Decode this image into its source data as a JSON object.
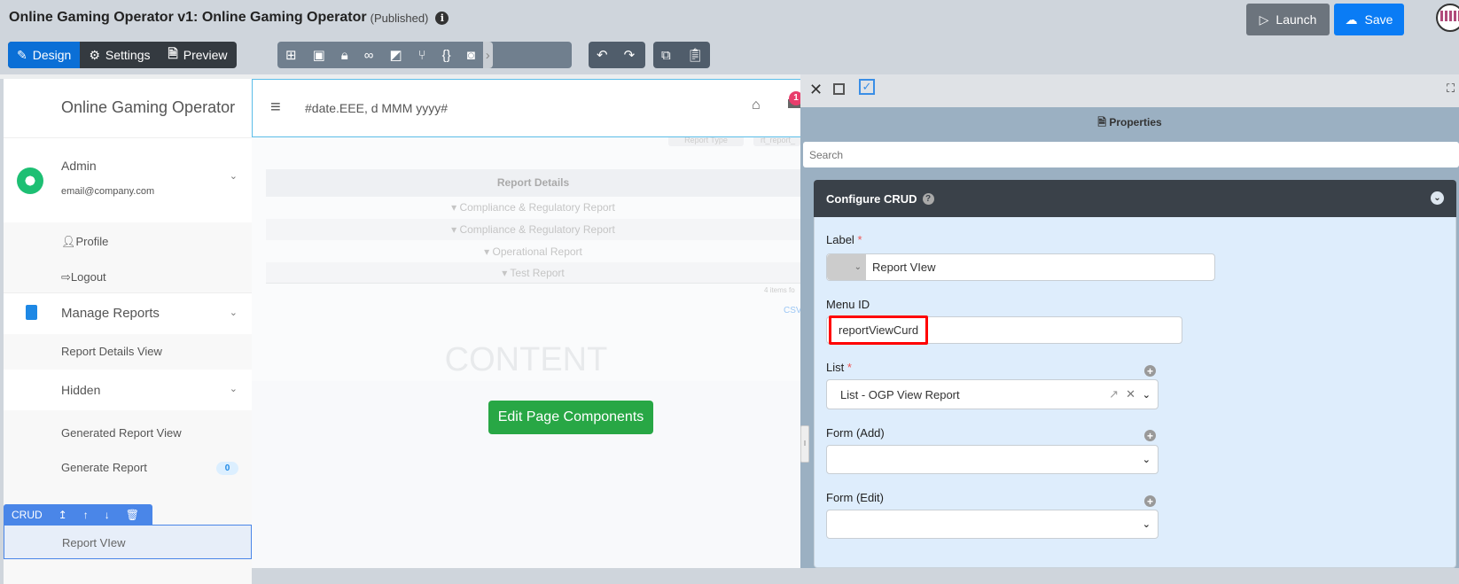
{
  "header": {
    "title": "Online Gaming Operator v1: Online Gaming Operator",
    "status": "(Published)",
    "launch": "Launch",
    "save": "Save"
  },
  "modes": [
    {
      "label": "Design"
    },
    {
      "label": "Settings"
    },
    {
      "label": "Preview"
    }
  ],
  "toolbar_icons": [
    "sitemap-icon",
    "page-icon",
    "lock-icon",
    "binoculars-icon",
    "translate-icon",
    "branch-icon",
    "code-braces-icon",
    "camera-icon"
  ],
  "app": {
    "brand": "Online Gaming Operator",
    "date_format": "#date.EEE, d MMM yyyy#",
    "notification_count": "1"
  },
  "sidebar": {
    "user_name": "Admin",
    "user_email": "email@company.com",
    "profile": "Profile",
    "logout": "Logout",
    "manage_reports": "Manage Reports",
    "report_details_view": "Report Details View",
    "hidden": "Hidden",
    "generated_report_view": "Generated Report View",
    "generate_report": "Generate Report",
    "generate_report_badge": "0",
    "crud_tag": "CRUD",
    "report_view": "Report VIew"
  },
  "content": {
    "filter1": "Report Type",
    "filter2": "rt_report_",
    "table_header": "Report Details",
    "rows": [
      "Compliance & Regulatory Report",
      "Compliance & Regulatory Report",
      "Operational Report",
      "Test Report"
    ],
    "items_found": "4 items fo",
    "csv": "CSV",
    "placeholder": "CONTENT",
    "edit_button": "Edit Page Components"
  },
  "panel": {
    "title": "Properties",
    "search_placeholder": "Search",
    "section": "Configure CRUD",
    "label_label": "Label",
    "label_value": "Report VIew",
    "menu_id_label": "Menu ID",
    "menu_id_value": "reportViewCurd",
    "list_label": "List",
    "list_value": "List - OGP View Report",
    "form_add_label": "Form (Add)",
    "form_edit_label": "Form (Edit)"
  },
  "colors": {
    "design_active": "#0b6fd6",
    "save": "#0a7cf5",
    "launch": "#6c747d",
    "edit_button": "#28a745",
    "highlight": "#ff0000",
    "crud_bar": "#4a86e8"
  }
}
